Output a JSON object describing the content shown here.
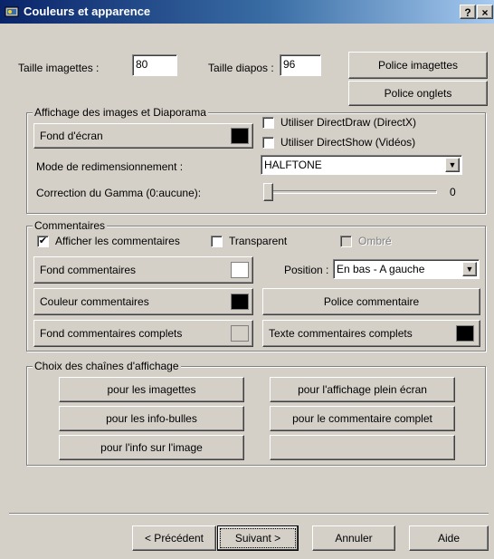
{
  "window": {
    "title": "Couleurs et apparence",
    "help_label": "?",
    "close_label": "×"
  },
  "top": {
    "thumb_size_label": "Taille imagettes :",
    "thumb_size_value": "80",
    "slide_size_label": "Taille diapos :",
    "slide_size_value": "96",
    "thumb_font_button": "Police imagettes",
    "tab_font_button": "Police onglets"
  },
  "display_group": {
    "title": "Affichage des images et Diaporama",
    "background_button": "Fond d'écran",
    "background_color": "#000000",
    "directdraw_label": "Utiliser DirectDraw (DirectX)",
    "directdraw_checked": false,
    "directshow_label": "Utiliser DirectShow (Vidéos)",
    "directshow_checked": false,
    "resize_mode_label": "Mode de redimensionnement :",
    "resize_mode_value": "HALFTONE",
    "gamma_label": "Correction du Gamma (0:aucune):",
    "gamma_value": "0",
    "gamma_level": 0
  },
  "comments_group": {
    "title": "Commentaires",
    "show_comments_label": "Afficher les commentaires",
    "show_comments_checked": true,
    "transparent_label": "Transparent",
    "transparent_checked": false,
    "shadow_label": "Ombré",
    "shadow_checked": false,
    "bg_button": "Fond commentaires",
    "bg_color": "#ffffff",
    "position_label": "Position :",
    "position_value": "En bas - A gauche",
    "color_button": "Couleur commentaires",
    "text_color": "#000000",
    "font_button": "Police commentaire",
    "full_bg_button": "Fond commentaires complets",
    "full_bg_color": "#d4d0c8",
    "full_text_button": "Texte commentaires complets",
    "full_text_color": "#000000"
  },
  "strings_group": {
    "title": "Choix des chaînes d'affichage",
    "thumbs_button": "pour les imagettes",
    "fullscreen_button": "pour l'affichage plein écran",
    "tooltips_button": "pour les info-bulles",
    "full_comment_button": "pour le commentaire complet",
    "image_info_button": "pour l'info sur l'image",
    "empty_button": ""
  },
  "footer": {
    "previous_button": "< Précédent",
    "next_button": "Suivant >",
    "cancel_button": "Annuler",
    "help_button": "Aide"
  }
}
